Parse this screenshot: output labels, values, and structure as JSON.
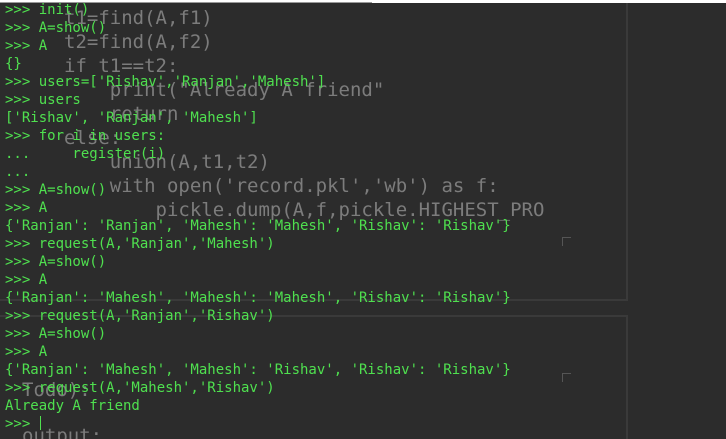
{
  "terminal": {
    "lines": [
      ">>> init()",
      ">>> A=show()",
      ">>> A",
      "{}",
      ">>> users=['Rishav','Ranjan','Mahesh']",
      ">>> users",
      "['Rishav', 'Ranjan', 'Mahesh']",
      ">>> for i in users:",
      "...     register(i)",
      "...",
      ">>> A=show()",
      ">>> A",
      "{'Ranjan': 'Ranjan', 'Mahesh': 'Mahesh', 'Rishav': 'Rishav'}",
      ">>> request(A,'Ranjan','Mahesh')",
      ">>> A=show()",
      ">>> A",
      "{'Ranjan': 'Mahesh', 'Mahesh': 'Mahesh', 'Rishav': 'Rishav'}",
      ">>> request(A,'Ranjan','Rishav')",
      ">>> A=show()",
      ">>> A",
      "{'Ranjan': 'Mahesh', 'Mahesh': 'Rishav', 'Rishav': 'Rishav'}",
      ">>> request(A,'Mahesh','Rishav')",
      "Already A friend",
      ">>> "
    ]
  },
  "ghost_editor": {
    "lines": [
      "t1=find(A,f1)",
      "t2=find(A,f2)",
      "if t1==t2:",
      "    print(\"Already A friend\"",
      "    return",
      "else:",
      "    union(A,t1,t2)",
      "    with open('record.pkl','wb') as f:",
      "        pickle.dump(A,f,pickle.HIGHEST_PRO",
      "Todo):",
      "output:"
    ]
  },
  "colors": {
    "terminal_bg": "#2c2c2c",
    "terminal_text": "#4fe04f",
    "ghost_text": "#8a8a8a"
  }
}
